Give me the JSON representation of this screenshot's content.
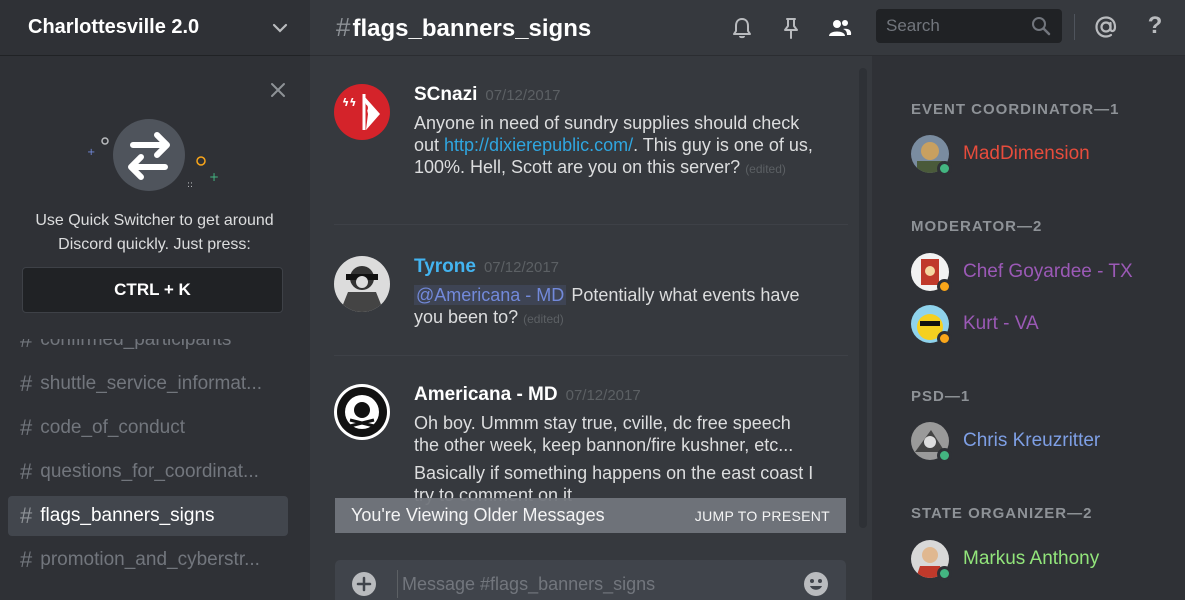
{
  "server": {
    "name": "Charlottesville 2.0"
  },
  "quick_switcher": {
    "line1": "Use Quick Switcher to get around",
    "line2": "Discord quickly. Just press:",
    "shortcut": "CTRL + K"
  },
  "channels": [
    {
      "name": "confirmed_participants",
      "active": false
    },
    {
      "name": "shuttle_service_informat...",
      "active": false
    },
    {
      "name": "code_of_conduct",
      "active": false
    },
    {
      "name": "questions_for_coordinat...",
      "active": false
    },
    {
      "name": "flags_banners_signs",
      "active": true
    },
    {
      "name": "promotion_and_cyberstr...",
      "active": false
    }
  ],
  "channel_hash": "#",
  "topbar": {
    "channel_name": "flags_banners_signs",
    "search_placeholder": "Search",
    "help": "?"
  },
  "messages": [
    {
      "author": "SCnazi",
      "author_color": "#ffffff",
      "timestamp": "07/12/2017",
      "text_before": "Anyone in need of sundry supplies should check out ",
      "link": "http://dixierepublic.com/",
      "text_after": ". This guy is one of us, 100%. Hell, Scott are you on this server?",
      "edited": "(edited)"
    },
    {
      "author": "Tyrone",
      "author_color": "#43b4f0",
      "timestamp": "07/12/2017",
      "mention": "@Americana - MD",
      "text": " Potentially what events have you been to?",
      "edited": "(edited)"
    },
    {
      "author": "Americana - MD",
      "author_color": "#ffffff",
      "timestamp": "07/12/2017",
      "text": "Oh boy. Ummm stay true, cville, dc free speech the other week, keep bannon/fire kushner, etc...",
      "text2": "Basically if something happens on the east coast I try to comment on it"
    }
  ],
  "older_banner": {
    "text": "You're Viewing Older Messages",
    "jump": "JUMP TO PRESENT"
  },
  "composer": {
    "placeholder": "Message #flags_banners_signs"
  },
  "members": {
    "groups": [
      {
        "role": "EVENT COORDINATOR—1",
        "members": [
          {
            "name": "MadDimension",
            "color": "#e74c3c",
            "status": "online"
          }
        ]
      },
      {
        "role": "MODERATOR—2",
        "members": [
          {
            "name": "Chef Goyardee - TX",
            "color": "#9b59b6",
            "status": "idle"
          },
          {
            "name": "Kurt - VA",
            "color": "#9b59b6",
            "status": "idle"
          }
        ]
      },
      {
        "role": "PSD—1",
        "members": [
          {
            "name": "Chris Kreuzritter",
            "color": "#7e9fe5",
            "status": "online"
          }
        ]
      },
      {
        "role": "STATE ORGANIZER—2",
        "members": [
          {
            "name": "Markus Anthony",
            "color": "#92e57b",
            "status": "online"
          }
        ]
      }
    ]
  },
  "status_colors": {
    "online": "#43b581",
    "idle": "#faa61a"
  }
}
